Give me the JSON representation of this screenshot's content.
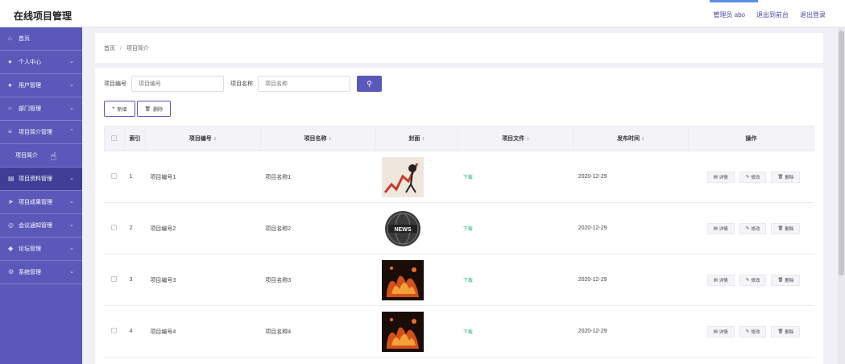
{
  "header": {
    "title": "在线项目管理",
    "user": "管理员 abo",
    "front": "退出到前台",
    "logout": "退出登录"
  },
  "sidebar": {
    "items": [
      {
        "label": "首页",
        "icon": "home-icon",
        "chev": false
      },
      {
        "label": "个人中心",
        "icon": "user-icon",
        "chev": true
      },
      {
        "label": "用户管理",
        "icon": "users-icon",
        "chev": true
      },
      {
        "label": "部门管理",
        "icon": "dept-icon",
        "chev": true
      },
      {
        "label": "项目简介管理",
        "icon": "list-icon",
        "chev": true,
        "open": true
      },
      {
        "label": "项目简介",
        "sub": true
      },
      {
        "label": "项目资料管理",
        "icon": "doc-icon",
        "chev": true,
        "active": true
      },
      {
        "label": "项目成果管理",
        "icon": "send-icon",
        "chev": true
      },
      {
        "label": "会议通知管理",
        "icon": "bell-icon",
        "chev": true
      },
      {
        "label": "论坛管理",
        "icon": "forum-icon",
        "chev": true
      },
      {
        "label": "系统管理",
        "icon": "gear-icon",
        "chev": true
      }
    ]
  },
  "breadcrumb": {
    "home": "首页",
    "sep": "/",
    "current": "项目简介"
  },
  "search": {
    "code_label": "项目编号",
    "code_placeholder": "项目编号",
    "name_label": "项目名称",
    "name_placeholder": "项目名称"
  },
  "actions": {
    "add": "新增",
    "delete": "删除"
  },
  "table": {
    "headers": [
      "索引",
      "项目编号",
      "项目名称",
      "封面",
      "项目文件",
      "发布时间",
      "操作"
    ],
    "rows": [
      {
        "index": "1",
        "code": "项目编号1",
        "name": "项目名称1",
        "file": "下载",
        "date": "2020-12-29",
        "cover": "chart"
      },
      {
        "index": "2",
        "code": "项目编号2",
        "name": "项目名称2",
        "file": "下载",
        "date": "2020-12-29",
        "cover": "news"
      },
      {
        "index": "3",
        "code": "项目编号3",
        "name": "项目名称3",
        "file": "下载",
        "date": "2020-12-29",
        "cover": "fire"
      },
      {
        "index": "4",
        "code": "项目编号4",
        "name": "项目名称4",
        "file": "下载",
        "date": "2020-12-29",
        "cover": "fire"
      }
    ],
    "ops": {
      "detail": "详情",
      "edit": "修改",
      "delete": "删除"
    }
  },
  "news_text": "NEWS",
  "colors": {
    "accent": "#5a58b8",
    "download": "#2bb673"
  }
}
